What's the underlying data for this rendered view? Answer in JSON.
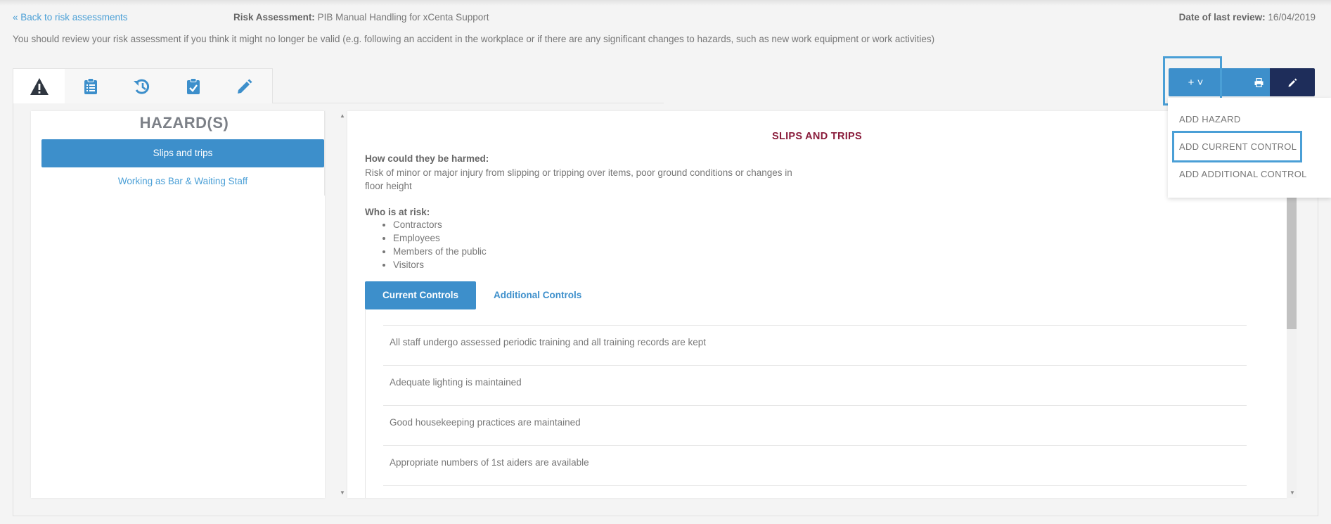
{
  "header": {
    "back_link": "« Back to risk assessments",
    "title_label": "Risk Assessment:",
    "title_value": "PIB Manual Handling for xCenta Support",
    "review_label": "Date of last review:",
    "review_value": "16/04/2019",
    "notice": "You should review your risk assessment if you think it might no longer be valid (e.g. following an accident in the workplace or if there are any significant changes to hazards, such as new work equipment or work activities)"
  },
  "tabs": [
    {
      "icon": "warning-icon",
      "active": true
    },
    {
      "icon": "clipboard-icon",
      "active": false
    },
    {
      "icon": "history-icon",
      "active": false
    },
    {
      "icon": "clipboard-check-icon",
      "active": false
    },
    {
      "icon": "pencil-icon",
      "active": false
    }
  ],
  "hazards": {
    "title": "HAZARD(S)",
    "items": [
      "Slips and trips",
      "Working as Bar & Waiting Staff"
    ]
  },
  "detail": {
    "name": "SLIPS AND TRIPS",
    "harmed_label": "How could they be harmed:",
    "harmed_text": "Risk of minor or major injury from slipping or tripping over items, poor ground conditions or changes in floor height",
    "at_risk_label": "Who is at risk:",
    "at_risk": [
      "Contractors",
      "Employees",
      "Members of the public",
      "Visitors"
    ],
    "control_tabs": [
      "Current Controls",
      "Additional Controls"
    ],
    "controls": [
      "All staff undergo assessed periodic training and all training records are kept",
      "Adequate lighting is maintained",
      "Good housekeeping practices are maintained",
      "Appropriate numbers of 1st aiders are available"
    ]
  },
  "actions": {
    "add_label": "+ ˅",
    "menu": [
      "ADD HAZARD",
      "ADD CURRENT CONTROL",
      "ADD ADDITIONAL CONTROL"
    ]
  },
  "colors": {
    "primary": "#3d8fcb",
    "dark_button": "#1e2d5a",
    "hazard_title": "#8a1d3c",
    "link": "#4a9fd6"
  }
}
